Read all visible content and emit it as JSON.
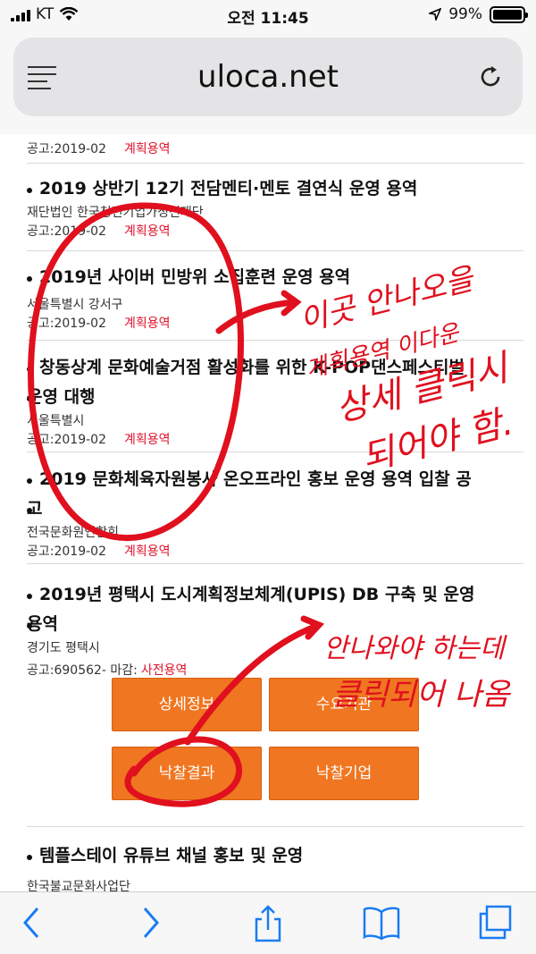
{
  "status": {
    "carrier": "KT",
    "time": "오전 11:45",
    "battery": "99%",
    "battery_fraction": 0.99
  },
  "browser": {
    "url": "uloca.net"
  },
  "items": [
    {
      "title": "",
      "org": "",
      "date": "공고:2019-02",
      "tag": "계획용역"
    },
    {
      "title": "2019 상반기 12기 전담멘티·멘토 결연식 운영 용역",
      "org": "재단법인 한국청년기업가정신재단",
      "date": "공고:2019-02",
      "tag": "계획용역"
    },
    {
      "title": "2019년 사이버 민방위 소집훈련 운영 용역",
      "org": "서울특별시 강서구",
      "date": "공고:2019-02",
      "tag": "계획용역"
    },
    {
      "title_line1": "창동상계 문화예술거점 활성화를 위한 K-POP댄스페스티벌",
      "title_line2": "운영 대행",
      "org": "서울특별시",
      "date": "공고:2019-02",
      "tag": "계획용역"
    },
    {
      "title_line1": "2019 문화체육자원봉사 온오프라인 홍보 운영 용역 입찰 공",
      "title_line2": "고",
      "org": "전국문화원연합회",
      "date": "공고:2019-02",
      "tag": "계획용역"
    },
    {
      "title_line1": "2019년 평택시 도시계획정보체계(UPIS) DB 구축 및 운영",
      "title_line2": "용역",
      "org": "경기도 평택시",
      "date": "공고:690562- 마감:",
      "tag": "사전용역"
    },
    {
      "title": "템플스테이 유튜브 채널 홍보 및 운영",
      "org": "한국불교문화사업단",
      "date": "",
      "tag": ""
    }
  ],
  "buttons": {
    "detail": "상세정보",
    "demand": "수요기관",
    "result": "낙찰결과",
    "winner": "낙찰기업"
  },
  "annotations": {
    "note1_line1": "이곳 안나오을",
    "note1_line2": "계획용역 이다운",
    "note1_line3": "상세 클릭시",
    "note1_line4": "되어야 함.",
    "note2_line1": "안나와야 하는데",
    "note2_line2": "클릭되어 나옴"
  },
  "colors": {
    "accent_button": "#f07621",
    "tag_red": "#e0102a",
    "annotation_red": "#e0101e"
  }
}
